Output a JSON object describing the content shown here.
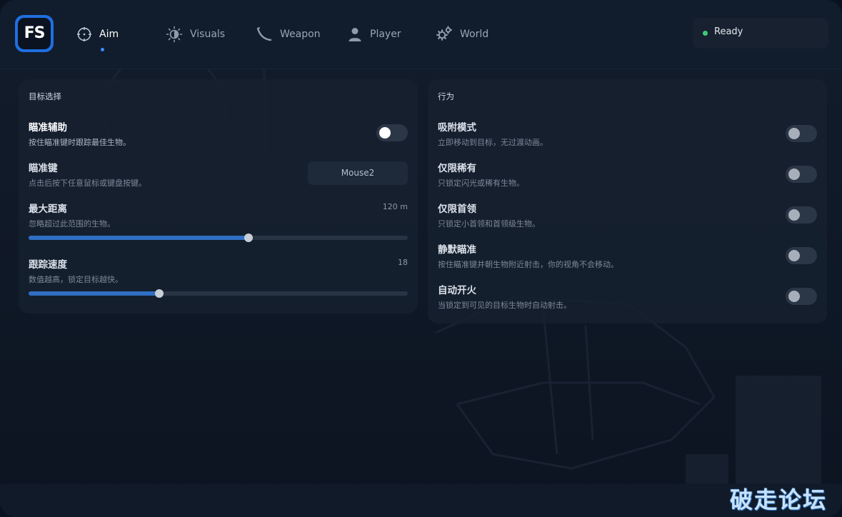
{
  "app": {
    "logo_text": "FS",
    "accent_color": "#3b8cff",
    "status_color": "#3fc97a"
  },
  "tabs": [
    {
      "label": "Aim",
      "icon": "crosshair-icon",
      "active": true
    },
    {
      "label": "Visuals",
      "icon": "sun-icon",
      "active": false
    },
    {
      "label": "Weapon",
      "icon": "fishing-rod-icon",
      "active": false
    },
    {
      "label": "Player",
      "icon": "user-icon",
      "active": false
    },
    {
      "label": "World",
      "icon": "gears-icon",
      "active": false
    }
  ],
  "status": {
    "label": "Ready"
  },
  "left_panel": {
    "title": "目标选择",
    "aim_assist": {
      "title": "瞄准辅助",
      "desc": "按住瞄准键时跟踪最佳生物。",
      "enabled": true
    },
    "aim_key": {
      "title": "瞄准键",
      "desc": "点击后按下任意鼠标或键盘按键。",
      "value": "Mouse2"
    },
    "max_distance": {
      "title": "最大距离",
      "desc": "忽略超过此范围的生物。",
      "value_label": "120 m",
      "fraction": 0.58
    },
    "track_speed": {
      "title": "跟踪速度",
      "desc": "数值越高，锁定目标越快。",
      "value_label": "18",
      "fraction": 0.345
    }
  },
  "right_panel": {
    "title": "行为",
    "rows": [
      {
        "title": "吸附模式",
        "desc": "立即移动到目标，无过渡动画。",
        "enabled": false
      },
      {
        "title": "仅限稀有",
        "desc": "只锁定闪光或稀有生物。",
        "enabled": false
      },
      {
        "title": "仅限首领",
        "desc": "只锁定小首领和首领级生物。",
        "enabled": false
      },
      {
        "title": "静默瞄准",
        "desc": "按住瞄准键并朝生物附近射击，你的视角不会移动。",
        "enabled": false
      },
      {
        "title": "自动开火",
        "desc": "当锁定到可见的目标生物时自动射击。",
        "enabled": false
      }
    ]
  },
  "watermark": "破走论坛"
}
